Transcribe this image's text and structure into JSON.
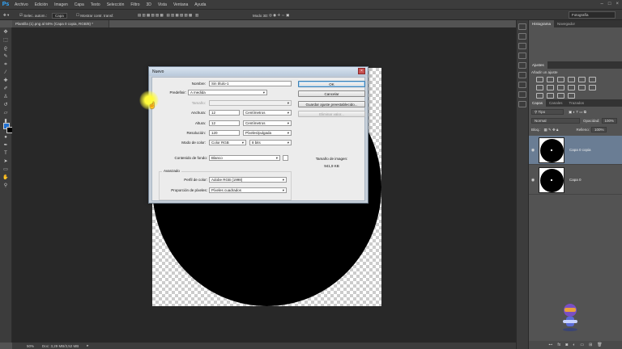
{
  "app": {
    "logo": "Ps",
    "menu": [
      "Archivo",
      "Edición",
      "Imagen",
      "Capa",
      "Texto",
      "Selección",
      "Filtro",
      "3D",
      "Vista",
      "Ventana",
      "Ayuda"
    ],
    "window_controls": [
      "–",
      "□",
      "×"
    ]
  },
  "options_bar": {
    "auto_select": "Selec. autom.:",
    "auto_select_value": "Capa",
    "show_transform": "Mostrar contr. transf.",
    "mode_3d": "Modo 3D:",
    "workspace": "Fotografía"
  },
  "document": {
    "tab": "Plantilla (1).png al 50% (Capa 0 copia, RGB/8) *",
    "status_zoom": "50%",
    "status_doc": "Doc: 3,29 MB/3,52 MB"
  },
  "dialog": {
    "title": "Nuevo",
    "close": "×",
    "fields": {
      "name_label": "Nombre:",
      "name_value": "Sin título-1",
      "preset_label": "Predefinir:",
      "preset_value": "A medida",
      "size_label": "Tamaño:",
      "width_label": "Anchura:",
      "width_value": "12",
      "width_unit": "Centímetros",
      "height_label": "Altura:",
      "height_value": "12",
      "height_unit": "Centímetros",
      "resolution_label": "Resolución:",
      "resolution_value": "120",
      "resolution_unit": "Píxeles/pulgada",
      "color_mode_label": "Modo de color:",
      "color_mode_value": "Color RGB",
      "color_depth": "8 bits",
      "background_label": "Contenido de fondo:",
      "background_value": "Blanco",
      "advanced_label": "Avanzado",
      "profile_label": "Perfil de color:",
      "profile_value": "Adobe RGB (1998)",
      "pixel_aspect_label": "Proporción de píxeles:",
      "pixel_aspect_value": "Píxeles cuadrados"
    },
    "buttons": {
      "ok": "OK",
      "cancel": "Cancelar",
      "save_preset": "Guardar ajuste preestablecido...",
      "delete_preset": "Eliminar valor..."
    },
    "image_size_label": "Tamaño de imagen:",
    "image_size_value": "941,9 KB"
  },
  "panels": {
    "top_tabs": [
      "Histograma",
      "Navegador"
    ],
    "adjust_tabs": [
      "Ajustes"
    ],
    "adjust_title": "Añadir un ajuste",
    "layer_tabs": [
      "Capas",
      "Canales",
      "Trazados"
    ],
    "kind_filter": "Tipo",
    "blend_mode": "Normal",
    "opacity_label": "Opacidad:",
    "opacity_value": "100%",
    "lock_label": "Bloq.:",
    "fill_label": "Relleno:",
    "fill_value": "100%",
    "layers": [
      {
        "name": "Capa 0 copia",
        "selected": true
      },
      {
        "name": "Capa 0",
        "selected": false
      }
    ],
    "footer_icons": [
      "link-icon",
      "fx-icon",
      "mask-icon",
      "adjustment-icon",
      "folder-icon",
      "new-layer-icon",
      "trash-icon"
    ]
  },
  "colors": {
    "foreground": "#1f6fd0",
    "background": "#000000",
    "selected_layer": "#6a7d94"
  }
}
